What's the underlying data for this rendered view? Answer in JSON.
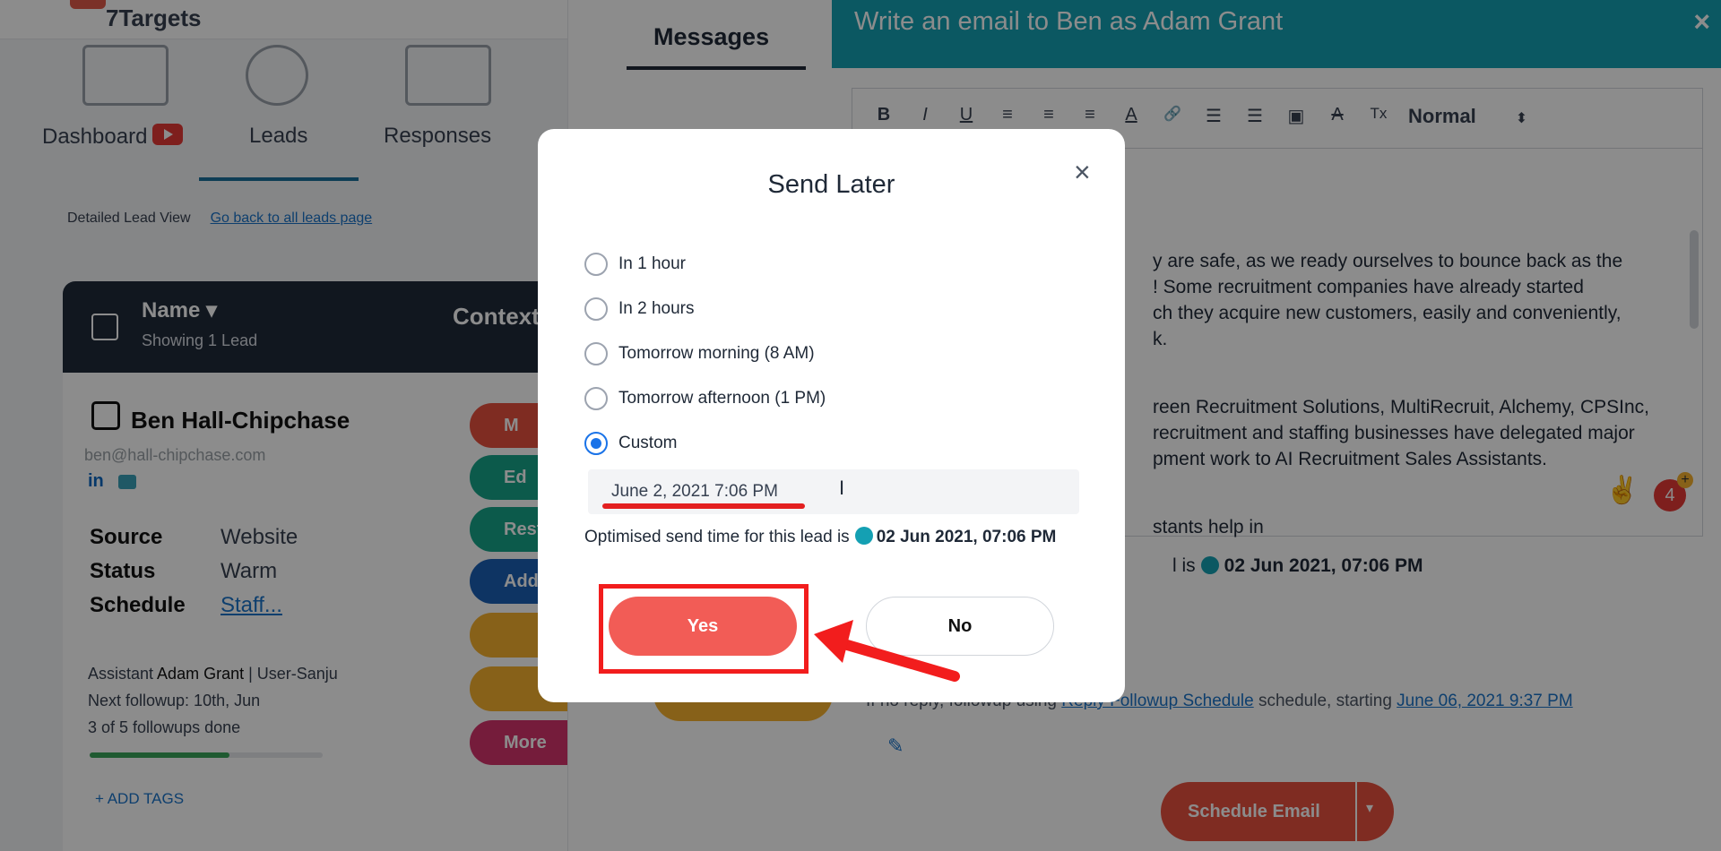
{
  "app": {
    "brand": "7Targets",
    "nav": [
      "Dashboard",
      "Leads",
      "Responses"
    ],
    "breadcrumb_label": "Detailed Lead View",
    "breadcrumb_link": "Go back to all leads page",
    "table_header": {
      "name_label": "Name ▾",
      "showing": "Showing 1 Lead",
      "context_label": "Context"
    },
    "lead": {
      "name": "Ben Hall-Chipchase",
      "email": "ben@hall-chipchase.com",
      "linkedin_icon": "in",
      "source_label": "Source",
      "source_value": "Website",
      "status_label": "Status",
      "status_value": "Warm",
      "schedule_label": "Schedule",
      "schedule_value": "Staff...",
      "assistant_prefix": "Assistant",
      "assistant_name": "Adam Grant",
      "assistant_suffix": "| User-Sanju",
      "next_followup": "Next followup: 10th, Jun",
      "followups_done": "3 of 5 followups done",
      "followups_progress": 0.6,
      "add_tags": "+ ADD TAGS"
    },
    "pills": [
      {
        "label": "M",
        "color": "#e8503f"
      },
      {
        "label": "Ed",
        "color": "#17a589"
      },
      {
        "label": "Resta",
        "color": "#17a589"
      },
      {
        "label": "Add",
        "color": "#1a5fb4"
      },
      {
        "label": "",
        "color": "#f6b12e"
      },
      {
        "label": "",
        "color": "#f6b12e"
      },
      {
        "label": "More",
        "color": "#d6336c"
      }
    ]
  },
  "messages": {
    "tab_label": "Messages"
  },
  "compose": {
    "title": "Write an email to Ben as Adam Grant",
    "close_icon": "×",
    "toolbar": {
      "bold": "B",
      "italic": "I",
      "underline": "U",
      "align_left": "≡",
      "align_center": "≡",
      "justify": "≡",
      "font_color": "A",
      "link": "🔗",
      "ordered_list": "☰",
      "bullet_list": "☰",
      "image": "▣",
      "clear_bg": "A",
      "clear_format": "Tx",
      "format_select": "Normal",
      "format_caret": "⬍"
    },
    "body_lines": [
      "y are safe, as we ready ourselves to bounce back as the",
      "! Some recruitment companies have already started",
      "ch they acquire new customers, easily and conveniently,",
      "k.",
      "",
      "reen Recruitment Solutions, MultiRecruit, Alchemy, CPSInc,",
      "recruitment and staffing businesses have delegated major",
      "pment work to AI Recruitment Sales Assistants.",
      "",
      "stants help in"
    ],
    "emoji": "✌",
    "notif_count": "4",
    "optimised_tail": "l is",
    "optimised_time": "02 Jun 2021, 07:06 PM",
    "followup_prefix": "If no reply, followup using",
    "followup_link": "Reply Followup Schedule",
    "followup_mid": "schedule, starting",
    "followup_date": "June 06, 2021 9:37 PM",
    "schedule_button": "Schedule Email",
    "schedule_caret": "▾"
  },
  "modal": {
    "title": "Send Later",
    "close_icon": "×",
    "options": [
      {
        "label": "In 1 hour",
        "checked": false
      },
      {
        "label": "In 2 hours",
        "checked": false
      },
      {
        "label": "Tomorrow morning (8 AM)",
        "checked": false
      },
      {
        "label": "Tomorrow afternoon (1 PM)",
        "checked": false
      },
      {
        "label": "Custom",
        "checked": true
      }
    ],
    "custom_date": "June 2, 2021 7:06 PM",
    "cursor_glyph": "I",
    "optimised_label": "Optimised send time for this lead is",
    "optimised_time": "02 Jun 2021, 07:06 PM",
    "yes_label": "Yes",
    "no_label": "No"
  },
  "colors": {
    "accent_teal": "#14a0b3",
    "yes_red": "#f25c56",
    "highlight_red": "#f21d1d",
    "radio_blue": "#1a73e8"
  }
}
